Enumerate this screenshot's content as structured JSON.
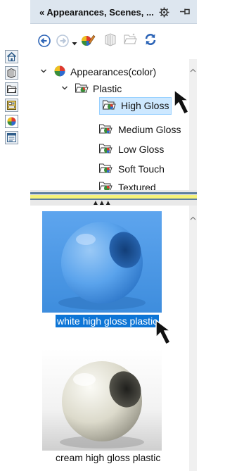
{
  "pane": {
    "title": "« Appearances, Scenes, ...",
    "gear_icon": "gear-icon",
    "pin_icon": "pin-icon"
  },
  "toolbar": {
    "back_icon": "back-arrow-icon",
    "forward_icon": "forward-arrow-icon",
    "dropdown_icon": "dropdown-triangle-icon",
    "edit_appearance_icon": "edit-appearance-icon",
    "add_folder_icon": "add-file-location-icon",
    "open_folder_icon": "open-folder-icon",
    "refresh_icon": "refresh-icon"
  },
  "side_tabs": [
    {
      "icon": "home-icon"
    },
    {
      "icon": "library-icon"
    },
    {
      "icon": "folder-icon"
    },
    {
      "icon": "view-palette-icon"
    },
    {
      "icon": "appearances-icon",
      "active": true
    },
    {
      "icon": "custom-properties-icon"
    }
  ],
  "tree": {
    "root_label": "Appearances(color)",
    "category_label": "Plastic",
    "items": [
      {
        "label": "High Gloss",
        "selected": true
      },
      {
        "label": "Medium Gloss"
      },
      {
        "label": "Low Gloss"
      },
      {
        "label": "Soft Touch"
      },
      {
        "label": "Textured"
      }
    ]
  },
  "gallery": {
    "items": [
      {
        "label": "white high gloss plastic",
        "selected": true,
        "color": "#4f9be8"
      },
      {
        "label": "cream high gloss plastic",
        "selected": false,
        "color": "#e8e6dc"
      }
    ]
  },
  "colors": {
    "selection_blue": "#0d75d6",
    "tree_selection": "#cde8ff",
    "splitter_yellow": "#f5f27a",
    "title_bar": "#dde6ef"
  }
}
